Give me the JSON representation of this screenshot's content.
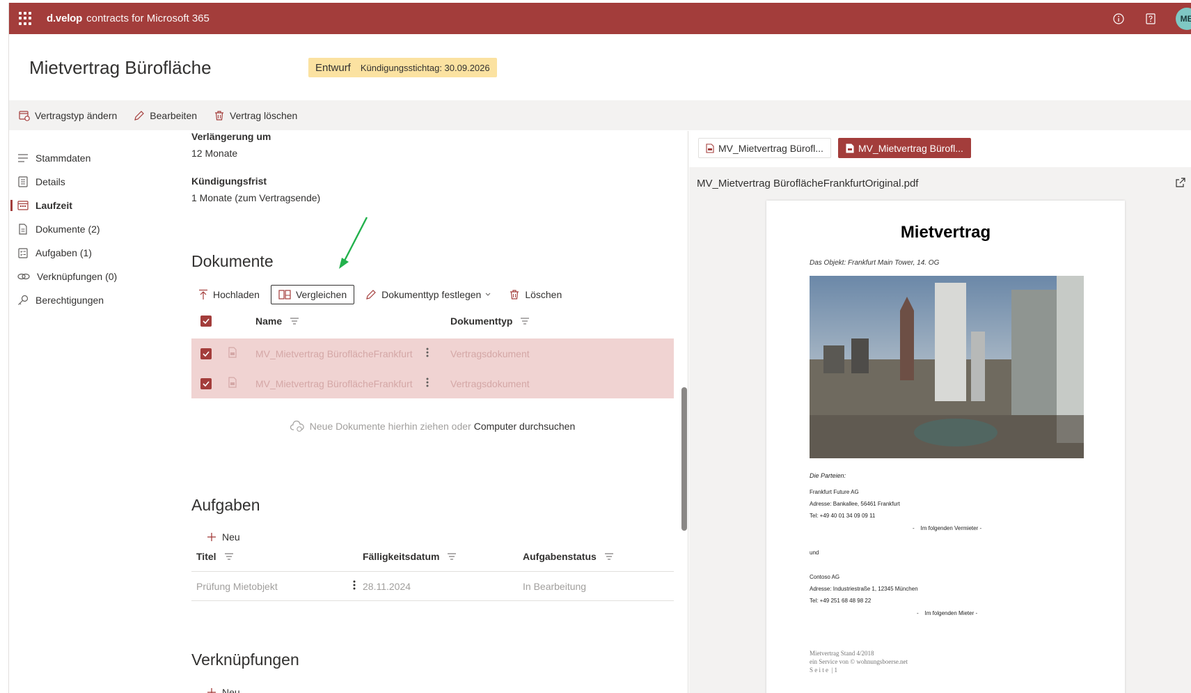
{
  "app": {
    "brand": "d.velop",
    "name": "contracts for Microsoft 365",
    "avatar_initials": "MB",
    "accent_color": "#a33d3b"
  },
  "header": {
    "title": "Mietvertrag Bürofläche",
    "status": "Entwurf",
    "status_detail": "Kündigungsstichtag: 30.09.2026"
  },
  "toolbar": {
    "change_type": "Vertragstyp ändern",
    "edit": "Bearbeiten",
    "delete": "Vertrag löschen"
  },
  "nav": {
    "items": [
      {
        "label": "Stammdaten",
        "icon": "list-icon"
      },
      {
        "label": "Details",
        "icon": "document-lines-icon"
      },
      {
        "label": "Laufzeit",
        "icon": "calendar-icon",
        "active": true
      },
      {
        "label": "Dokumente (2)",
        "icon": "document-icon"
      },
      {
        "label": "Aufgaben (1)",
        "icon": "tasks-icon"
      },
      {
        "label": "Verknüpfungen (0)",
        "icon": "link-icon"
      },
      {
        "label": "Berechtigungen",
        "icon": "key-icon"
      }
    ]
  },
  "laufzeit": {
    "renewal_label": "Verlängerung um",
    "renewal_value": "12 Monate",
    "notice_label": "Kündigungsfrist",
    "notice_value": "1 Monate (zum Vertragsende)"
  },
  "documents": {
    "title": "Dokumente",
    "upload": "Hochladen",
    "compare": "Vergleichen",
    "set_type": "Dokumenttyp festlegen",
    "delete": "Löschen",
    "col_name": "Name",
    "col_type": "Dokumenttyp",
    "rows": [
      {
        "name": "MV_Mietvertrag BüroflächeFrankfurt",
        "type": "Vertragsdokument"
      },
      {
        "name": "MV_Mietvertrag BüroflächeFrankfurt",
        "type": "Vertragsdokument"
      }
    ],
    "drop_text": "Neue Dokumente hierhin ziehen oder",
    "drop_link": "Computer durchsuchen"
  },
  "tasks": {
    "title": "Aufgaben",
    "new": "Neu",
    "col_title": "Titel",
    "col_due": "Fälligkeitsdatum",
    "col_status": "Aufgabenstatus",
    "rows": [
      {
        "title": "Prüfung Mietobjekt",
        "due": "28.11.2024",
        "status": "In Bearbeitung"
      }
    ]
  },
  "links": {
    "title": "Verknüpfungen",
    "new": "Neu"
  },
  "viewer": {
    "tabs": [
      "MV_Mietvertrag Bürofl...",
      "MV_Mietvertrag Bürofl..."
    ],
    "active_tab": 1,
    "filename": "MV_Mietvertrag BüroflächeFrankfurtOriginal.pdf",
    "pdf": {
      "title": "Mietvertrag",
      "subtitle": "Das Objekt: Frankfurt Main Tower, 14. OG",
      "parties_label": "Die Parteien:",
      "landlord_name": "Frankfurt Future AG",
      "landlord_address": "Adresse: Bankallee, 56461 Frankfurt",
      "landlord_tel": "Tel: +49 40 01 34 09 09 11",
      "landlord_role": "-    Im folgenden Vermieter -",
      "and": "und",
      "tenant_name": "Contoso AG",
      "tenant_address": "Adresse: Industriestraße 1, 12345 München",
      "tenant_tel": "Tel: +49 251 68 48 98 22",
      "tenant_role": "-    Im folgenden Mieter -",
      "footer1": "Mietvertrag Stand 4/2018",
      "footer2": "ein Service von © wohnungsboerse.net",
      "footer3": "S e i t e  | 1"
    }
  }
}
